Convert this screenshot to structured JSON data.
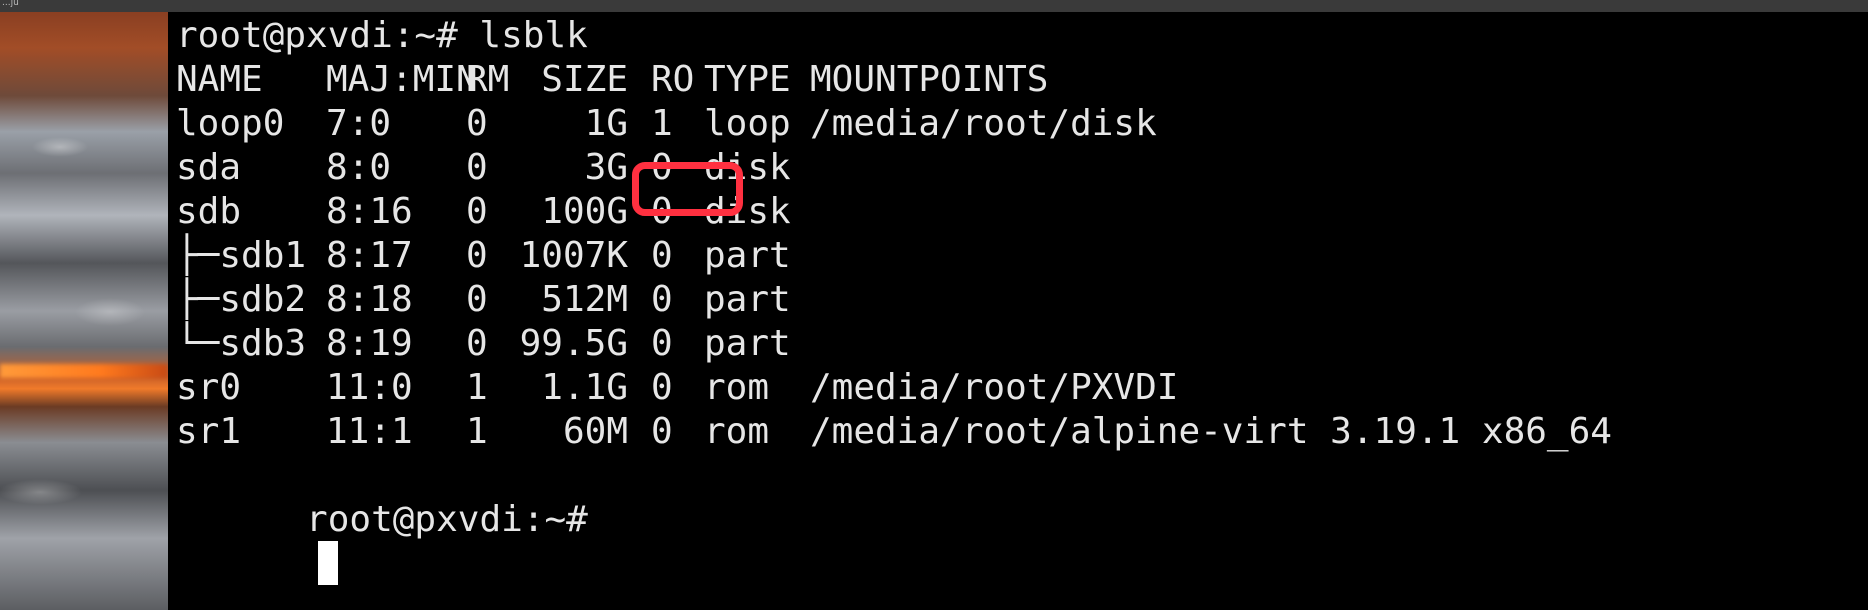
{
  "window": {
    "top_bar_text": "...ju"
  },
  "terminal": {
    "command_line": "root@pxvdi:~# lsblk",
    "prompt": "root@pxvdi:~#",
    "headers": {
      "name": "NAME",
      "majmin": "MAJ:MIN",
      "rm": "RM",
      "size": "SIZE",
      "ro": "RO",
      "type": "TYPE",
      "mountpoints": "MOUNTPOINTS"
    },
    "rows": [
      {
        "name": "loop0",
        "majmin": "7:0",
        "rm": "0",
        "size": "1G",
        "ro": "1",
        "type": "loop",
        "mountpoints": "/media/root/disk"
      },
      {
        "name": "sda",
        "majmin": "8:0",
        "rm": "0",
        "size": "3G",
        "ro": "0",
        "type": "disk",
        "mountpoints": ""
      },
      {
        "name": "sdb",
        "majmin": "8:16",
        "rm": "0",
        "size": "100G",
        "ro": "0",
        "type": "disk",
        "mountpoints": ""
      },
      {
        "name": "├─sdb1",
        "majmin": "8:17",
        "rm": "0",
        "size": "1007K",
        "ro": "0",
        "type": "part",
        "mountpoints": ""
      },
      {
        "name": "├─sdb2",
        "majmin": "8:18",
        "rm": "0",
        "size": "512M",
        "ro": "0",
        "type": "part",
        "mountpoints": ""
      },
      {
        "name": "└─sdb3",
        "majmin": "8:19",
        "rm": "0",
        "size": "99.5G",
        "ro": "0",
        "type": "part",
        "mountpoints": ""
      },
      {
        "name": "sr0",
        "majmin": "11:0",
        "rm": "1",
        "size": "1.1G",
        "ro": "0",
        "type": "rom",
        "mountpoints": "/media/root/PXVDI"
      },
      {
        "name": "sr1",
        "majmin": "11:1",
        "rm": "1",
        "size": "60M",
        "ro": "0",
        "type": "rom",
        "mountpoints": "/media/root/alpine-virt 3.19.1 x86_64"
      }
    ]
  },
  "colors": {
    "terminal_bg": "#000000",
    "terminal_fg": "#e6e6e6",
    "highlight": "#ff3040"
  }
}
